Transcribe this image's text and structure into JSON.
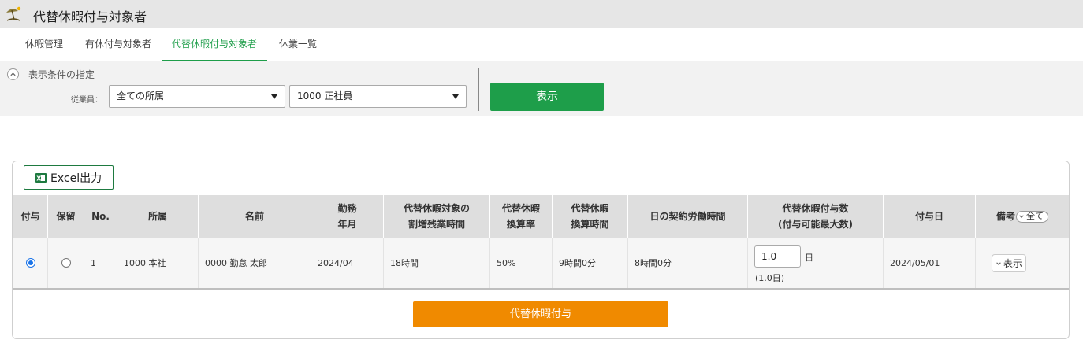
{
  "app": {
    "title": "代替休暇付与対象者",
    "logo_icon": "beach-umbrella-icon"
  },
  "tabs": [
    {
      "label": "休暇管理",
      "active": false
    },
    {
      "label": "有休付与対象者",
      "active": false
    },
    {
      "label": "代替休暇付与対象者",
      "active": true
    },
    {
      "label": "休業一覧",
      "active": false
    }
  ],
  "filter": {
    "title": "表示条件の指定",
    "employee_label": "従業員：",
    "department_select": "全ての所属",
    "employment_select": "1000 正社員",
    "show_button": "表示"
  },
  "toolbar": {
    "excel_label": "Excel出力"
  },
  "table": {
    "headers": {
      "grant": "付与",
      "hold": "保留",
      "no": "No.",
      "dept": "所属",
      "name": "名前",
      "work_month": "勤務\n年月",
      "overtime": "代替休暇対象の\n割増残業時間",
      "rate": "代替休暇\n換算率",
      "conv_time": "代替休暇\n換算時間",
      "daily_hours": "日の契約労働時間",
      "grant_days": "代替休暇付与数\n(付与可能最大数)",
      "grant_date": "付与日",
      "note": "備考",
      "all_toggle": "全て"
    },
    "rows": [
      {
        "grant_checked": true,
        "hold_checked": false,
        "no": "1",
        "dept": "1000 本社",
        "name": "0000 勤怠 太郎",
        "work_month": "2024/04",
        "overtime": "18時間",
        "rate": "50%",
        "conv_time": "9時間0分",
        "daily_hours": "8時間0分",
        "grant_value": "1.0",
        "grant_unit": "日",
        "grant_max": "(1.0日)",
        "grant_date": "2024/05/01",
        "note_button": "表示"
      }
    ]
  },
  "actions": {
    "grant_button": "代替休暇付与"
  },
  "colors": {
    "accent": "#1e9e4a",
    "grant": "#f08a00"
  }
}
